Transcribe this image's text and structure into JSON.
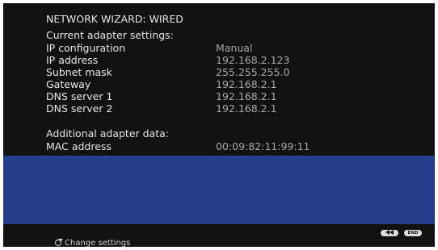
{
  "title": "NETWORK WIZARD: WIRED",
  "current_section": "Current adapter settings:",
  "settings": [
    {
      "label": "IP configuration",
      "value": "Manual"
    },
    {
      "label": "IP address",
      "value": "192.168.2.123"
    },
    {
      "label": "Subnet mask",
      "value": "255.255.255.0"
    },
    {
      "label": "Gateway",
      "value": "192.168.2.1"
    },
    {
      "label": "DNS server 1",
      "value": "192.168.2.1"
    },
    {
      "label": "DNS server 2",
      "value": "192.168.2.1"
    }
  ],
  "additional_section": "Additional adapter data:",
  "additional": [
    {
      "label": "MAC address",
      "value": "00:09:82:11:99:11"
    }
  ],
  "footer": {
    "rewind_icon": "rewind-icon",
    "end_label": "END",
    "change_icon": "refresh-icon",
    "change_label": "Change settings"
  },
  "colors": {
    "background": "#111111",
    "panel": "#253e8c",
    "text": "#e6e6e6",
    "value_text": "#a8a8a8"
  }
}
